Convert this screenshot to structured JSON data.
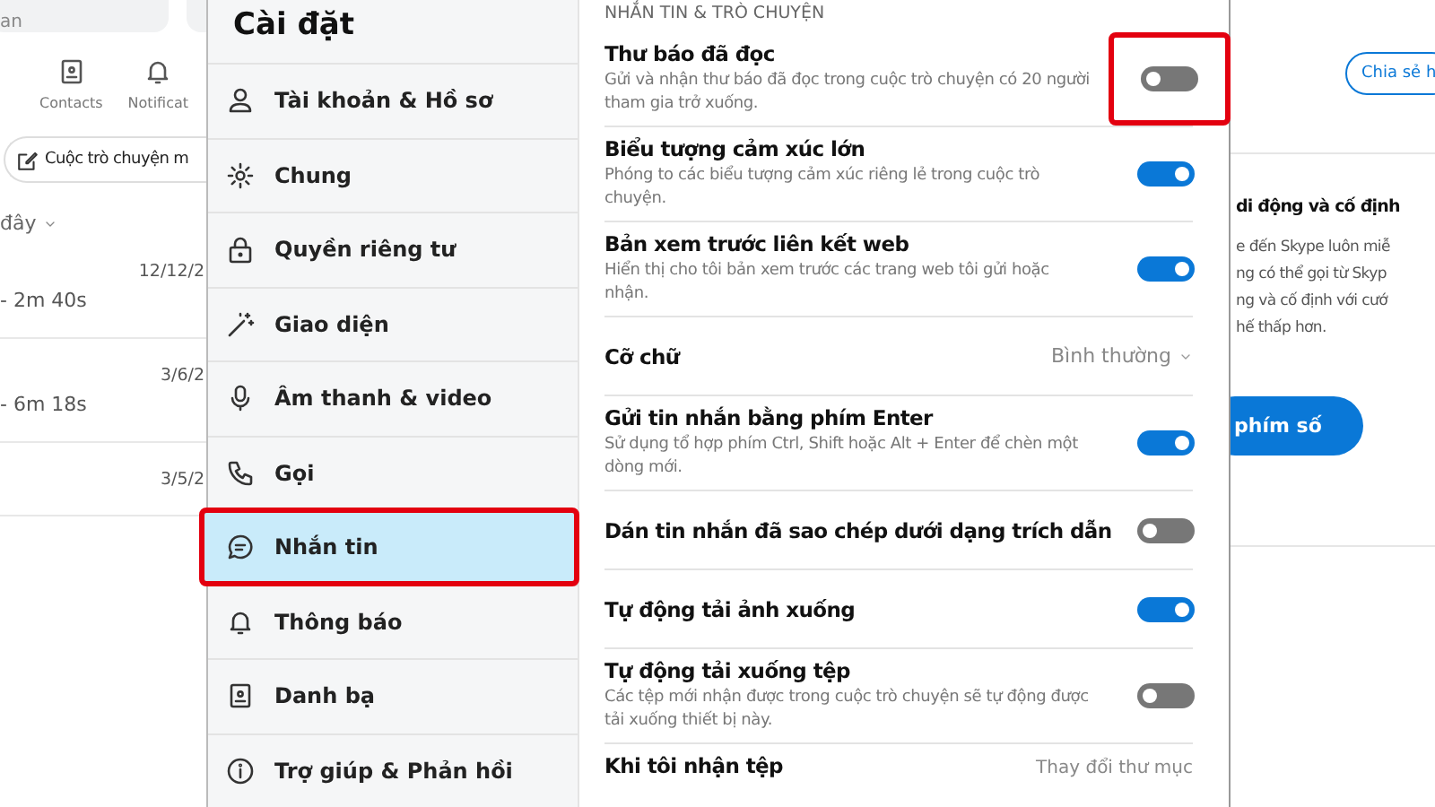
{
  "background_app": {
    "search_text": "an",
    "nav_tabs": [
      {
        "label": "Contacts"
      },
      {
        "label": "Notificat"
      }
    ],
    "new_chat_button": "Cuộc trò chuyện m",
    "recent_header": "đây",
    "calls": [
      {
        "date": "12/12/2",
        "duration": "- 2m 40s"
      },
      {
        "date": "3/6/2",
        "duration": "- 6m 18s"
      },
      {
        "date": "3/5/2"
      }
    ],
    "share_button": "Chia sẻ h",
    "promo": {
      "title": "di động và cố định",
      "lines": [
        "e đến Skype luôn miễ",
        "ng có thể gọi từ Skyp",
        "ng và cố định với cướ",
        "hế thấp hơn."
      ],
      "button": "phím số"
    }
  },
  "settings": {
    "title": "Cài đặt",
    "nav_items": [
      {
        "label": "Tài khoản & Hồ sơ",
        "selected": false,
        "highlighted": false
      },
      {
        "label": "Chung",
        "selected": false,
        "highlighted": false
      },
      {
        "label": "Quyền riêng tư",
        "selected": false,
        "highlighted": false
      },
      {
        "label": "Giao diện",
        "selected": false,
        "highlighted": false
      },
      {
        "label": "Âm thanh & video",
        "selected": false,
        "highlighted": false
      },
      {
        "label": "Gọi",
        "selected": false,
        "highlighted": false
      },
      {
        "label": "Nhắn tin",
        "selected": true,
        "highlighted": true
      },
      {
        "label": "Thông báo",
        "selected": false,
        "highlighted": false
      },
      {
        "label": "Danh bạ",
        "selected": false,
        "highlighted": false
      },
      {
        "label": "Trợ giúp & Phản hồi",
        "selected": false,
        "highlighted": false
      }
    ],
    "section_header": "NHẮN TIN & TRÒ CHUYỆN",
    "rows": [
      {
        "kind": "toggle",
        "title": "Thư báo đã đọc",
        "description": "Gửi và nhận thư báo đã đọc trong cuộc trò chuyện có 20 người tham gia trở xuống.",
        "on": false,
        "highlighted": true
      },
      {
        "kind": "toggle",
        "title": "Biểu tượng cảm xúc lớn",
        "description": "Phóng to các biểu tượng cảm xúc riêng lẻ trong cuộc trò chuyện.",
        "on": true
      },
      {
        "kind": "toggle",
        "title": "Bản xem trước liên kết web",
        "description": "Hiển thị cho tôi bản xem trước các trang web tôi gửi hoặc nhận.",
        "on": true
      },
      {
        "kind": "select",
        "title": "Cỡ chữ",
        "value": "Bình thường"
      },
      {
        "kind": "toggle",
        "title": "Gửi tin nhắn bằng phím Enter",
        "description": "Sử dụng tổ hợp phím Ctrl, Shift hoặc Alt + Enter để chèn một dòng mới.",
        "on": true
      },
      {
        "kind": "toggle",
        "title": "Dán tin nhắn đã sao chép dưới dạng trích dẫn",
        "on": false
      },
      {
        "kind": "toggle",
        "title": "Tự động tải ảnh xuống",
        "on": true
      },
      {
        "kind": "toggle",
        "title": "Tự động tải xuống tệp",
        "description": "Các tệp mới nhận được trong cuộc trò chuyện sẽ tự động được tải xuống thiết bị này.",
        "on": false
      },
      {
        "kind": "link",
        "title": "Khi tôi nhận tệp",
        "value": "Thay đổi thư mục"
      }
    ]
  }
}
